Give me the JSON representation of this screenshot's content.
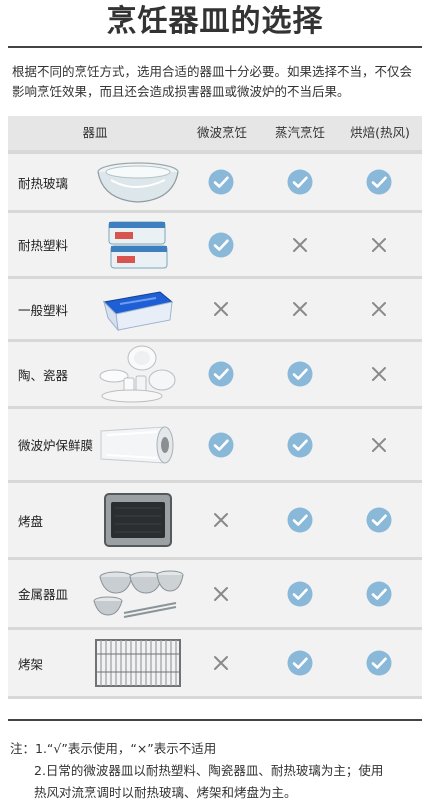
{
  "title": "烹饪器皿的选择",
  "intro": "根据不同的烹饪方式，选用合适的器皿十分必要。如果选择不当，不仅会影响烹饪效果，而且还会造成损害器皿或微波炉的不当后果。",
  "table": {
    "headers": [
      "器皿",
      "微波烹饪",
      "蒸汽烹饪",
      "烘焙(热风)"
    ],
    "rows": [
      {
        "name": "耐热玻璃",
        "image": "glass-bowl",
        "microwave": "yes",
        "steam": "yes",
        "bake": "yes"
      },
      {
        "name": "耐热塑料",
        "image": "plastic-containers",
        "microwave": "yes",
        "steam": "no",
        "bake": "no"
      },
      {
        "name": "一般塑料",
        "image": "plastic-box",
        "microwave": "no",
        "steam": "no",
        "bake": "no"
      },
      {
        "name": "陶、瓷器",
        "image": "ceramic-dishes",
        "microwave": "yes",
        "steam": "yes",
        "bake": "no"
      },
      {
        "name": "微波炉保鲜膜",
        "image": "cling-film-roll",
        "microwave": "yes",
        "steam": "yes",
        "bake": "no"
      },
      {
        "name": "烤盘",
        "image": "baking-tray",
        "microwave": "no",
        "steam": "yes",
        "bake": "yes"
      },
      {
        "name": "金属器皿",
        "image": "metal-bowls",
        "microwave": "no",
        "steam": "yes",
        "bake": "yes"
      },
      {
        "name": "烤架",
        "image": "wire-rack",
        "microwave": "no",
        "steam": "yes",
        "bake": "yes"
      }
    ]
  },
  "notes": {
    "line1": "注：1.“√”表示使用，“×”表示不适用",
    "line2": "2.日常的微波器皿以耐热塑料、陶瓷器皿、耐热玻璃为主；使用",
    "line3": "热风对流烹调时以耐热玻璃、烤架和烤盘为主。"
  },
  "colors": {
    "check": "#8ab8d9",
    "cross": "#8a8a8a"
  }
}
